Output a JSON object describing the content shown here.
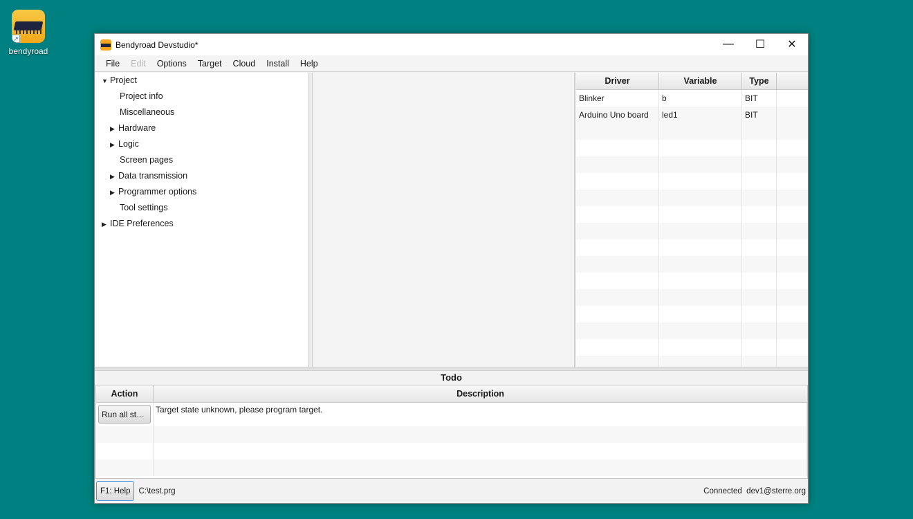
{
  "desktop": {
    "icon_label": "bendyroad",
    "icon": "bendyroad-app-icon"
  },
  "window": {
    "title": "Bendyroad Devstudio*",
    "controls": {
      "minimize": "—",
      "maximize": "☐",
      "close": "✕"
    }
  },
  "menu": {
    "items": [
      {
        "label": "File",
        "enabled": true
      },
      {
        "label": "Edit",
        "enabled": false
      },
      {
        "label": "Options",
        "enabled": true
      },
      {
        "label": "Target",
        "enabled": true
      },
      {
        "label": "Cloud",
        "enabled": true
      },
      {
        "label": "Install",
        "enabled": true
      },
      {
        "label": "Help",
        "enabled": true
      }
    ]
  },
  "tree": {
    "items": [
      {
        "label": "Project",
        "expanded": true
      },
      {
        "label": "Project info"
      },
      {
        "label": "Miscellaneous"
      },
      {
        "label": "Hardware",
        "expandable": true
      },
      {
        "label": "Logic",
        "expandable": true
      },
      {
        "label": "Screen pages"
      },
      {
        "label": "Data transmission",
        "expandable": true
      },
      {
        "label": "Programmer options",
        "expandable": true
      },
      {
        "label": "Tool settings"
      },
      {
        "label": "IDE Preferences",
        "expandable": true
      }
    ]
  },
  "drivers_table": {
    "headers": [
      "Driver",
      "Variable",
      "Type"
    ],
    "rows": [
      [
        "Blinker",
        "b",
        "BIT"
      ],
      [
        "Arduino Uno board",
        "led1",
        "BIT"
      ]
    ]
  },
  "todo": {
    "title": "Todo",
    "headers": [
      "Action",
      "Description"
    ],
    "rows": [
      {
        "action": "Run all ste...",
        "description": "Target state unknown, please program target."
      }
    ]
  },
  "status": {
    "help_button": "F1: Help",
    "path": "C:\\test.prg",
    "connection": "Connected",
    "user": "dev1@sterre.org"
  }
}
